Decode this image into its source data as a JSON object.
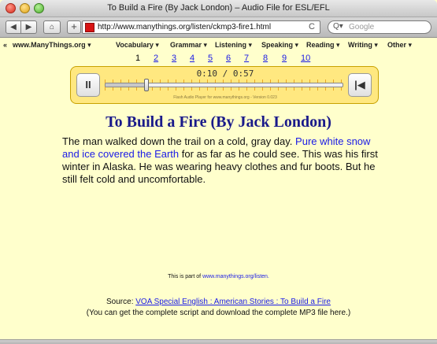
{
  "window": {
    "title": "To Build a Fire (By Jack London) – Audio File for ESL/EFL"
  },
  "toolbar": {
    "back_glyph": "◀",
    "forward_glyph": "▶",
    "home_glyph": "⌂",
    "add_glyph": "+",
    "url": "http://www.manythings.org/listen/ckmp3-fire1.html",
    "reload_glyph": "C",
    "search_placeholder": "Google",
    "search_icon": "Q▾"
  },
  "nav": {
    "items": [
      {
        "label": "«"
      },
      {
        "label": "www.ManyThings.org ▾"
      },
      {
        "label": "Vocabulary ▾"
      },
      {
        "label": "Grammar ▾"
      },
      {
        "label": "Listening ▾"
      },
      {
        "label": "Speaking ▾"
      },
      {
        "label": "Reading ▾"
      },
      {
        "label": "Writing ▾"
      },
      {
        "label": "Other ▾"
      }
    ]
  },
  "pages": {
    "current": "1",
    "links": [
      "2",
      "3",
      "4",
      "5",
      "6",
      "7",
      "8",
      "9",
      "10"
    ]
  },
  "player": {
    "time": "0:10 / 0:57",
    "progress": 0.175,
    "pause_glyph": "II",
    "rewind_glyph": "|◀",
    "caption": "Flash Audio Player for www.manythings.org - Version 0.023"
  },
  "content": {
    "title": "To Build a Fire (By Jack London)",
    "story_part1": "The man walked down the trail on a cold, gray day.",
    "story_highlight": "Pure white snow and ice covered the Earth",
    "story_part2": "for as far as he could see. This was his first winter in Alaska.  He was wearing heavy clothes and fur boots.  But he still felt cold and uncomfortable."
  },
  "footer": {
    "part_of_text": "This is part of",
    "part_of_link": "www.manythings.org/listen.",
    "source_label": "Source:",
    "source_link": "VOA Special English : American Stories : To Build a Fire",
    "note": "(You can get the complete script and download the complete MP3 file here.)"
  },
  "colors": {
    "background": "#ffffcc",
    "link": "#1a1ae6",
    "title": "#1a1a8a",
    "player_bg": "#ffe880"
  }
}
